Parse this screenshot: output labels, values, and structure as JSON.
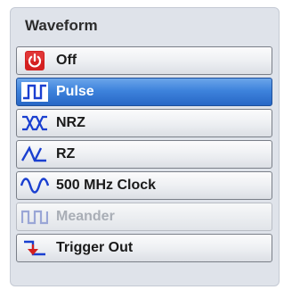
{
  "panel": {
    "title": "Waveform"
  },
  "items": [
    {
      "label": "Off",
      "icon": "power-icon",
      "selected": false,
      "enabled": true
    },
    {
      "label": "Pulse",
      "icon": "pulse-wave-icon",
      "selected": true,
      "enabled": true
    },
    {
      "label": "NRZ",
      "icon": "nrz-wave-icon",
      "selected": false,
      "enabled": true
    },
    {
      "label": "RZ",
      "icon": "rz-wave-icon",
      "selected": false,
      "enabled": true
    },
    {
      "label": "500 MHz Clock",
      "icon": "sine-wave-icon",
      "selected": false,
      "enabled": true
    },
    {
      "label": "Meander",
      "icon": "meander-wave-icon",
      "selected": false,
      "enabled": false
    },
    {
      "label": "Trigger Out",
      "icon": "trigger-out-icon",
      "selected": false,
      "enabled": true
    }
  ],
  "colors": {
    "selected_background": "#3e83dc",
    "icon_blue": "#1a3fd0",
    "power_red": "#d42020",
    "disabled_text": "#a9aeb6"
  }
}
